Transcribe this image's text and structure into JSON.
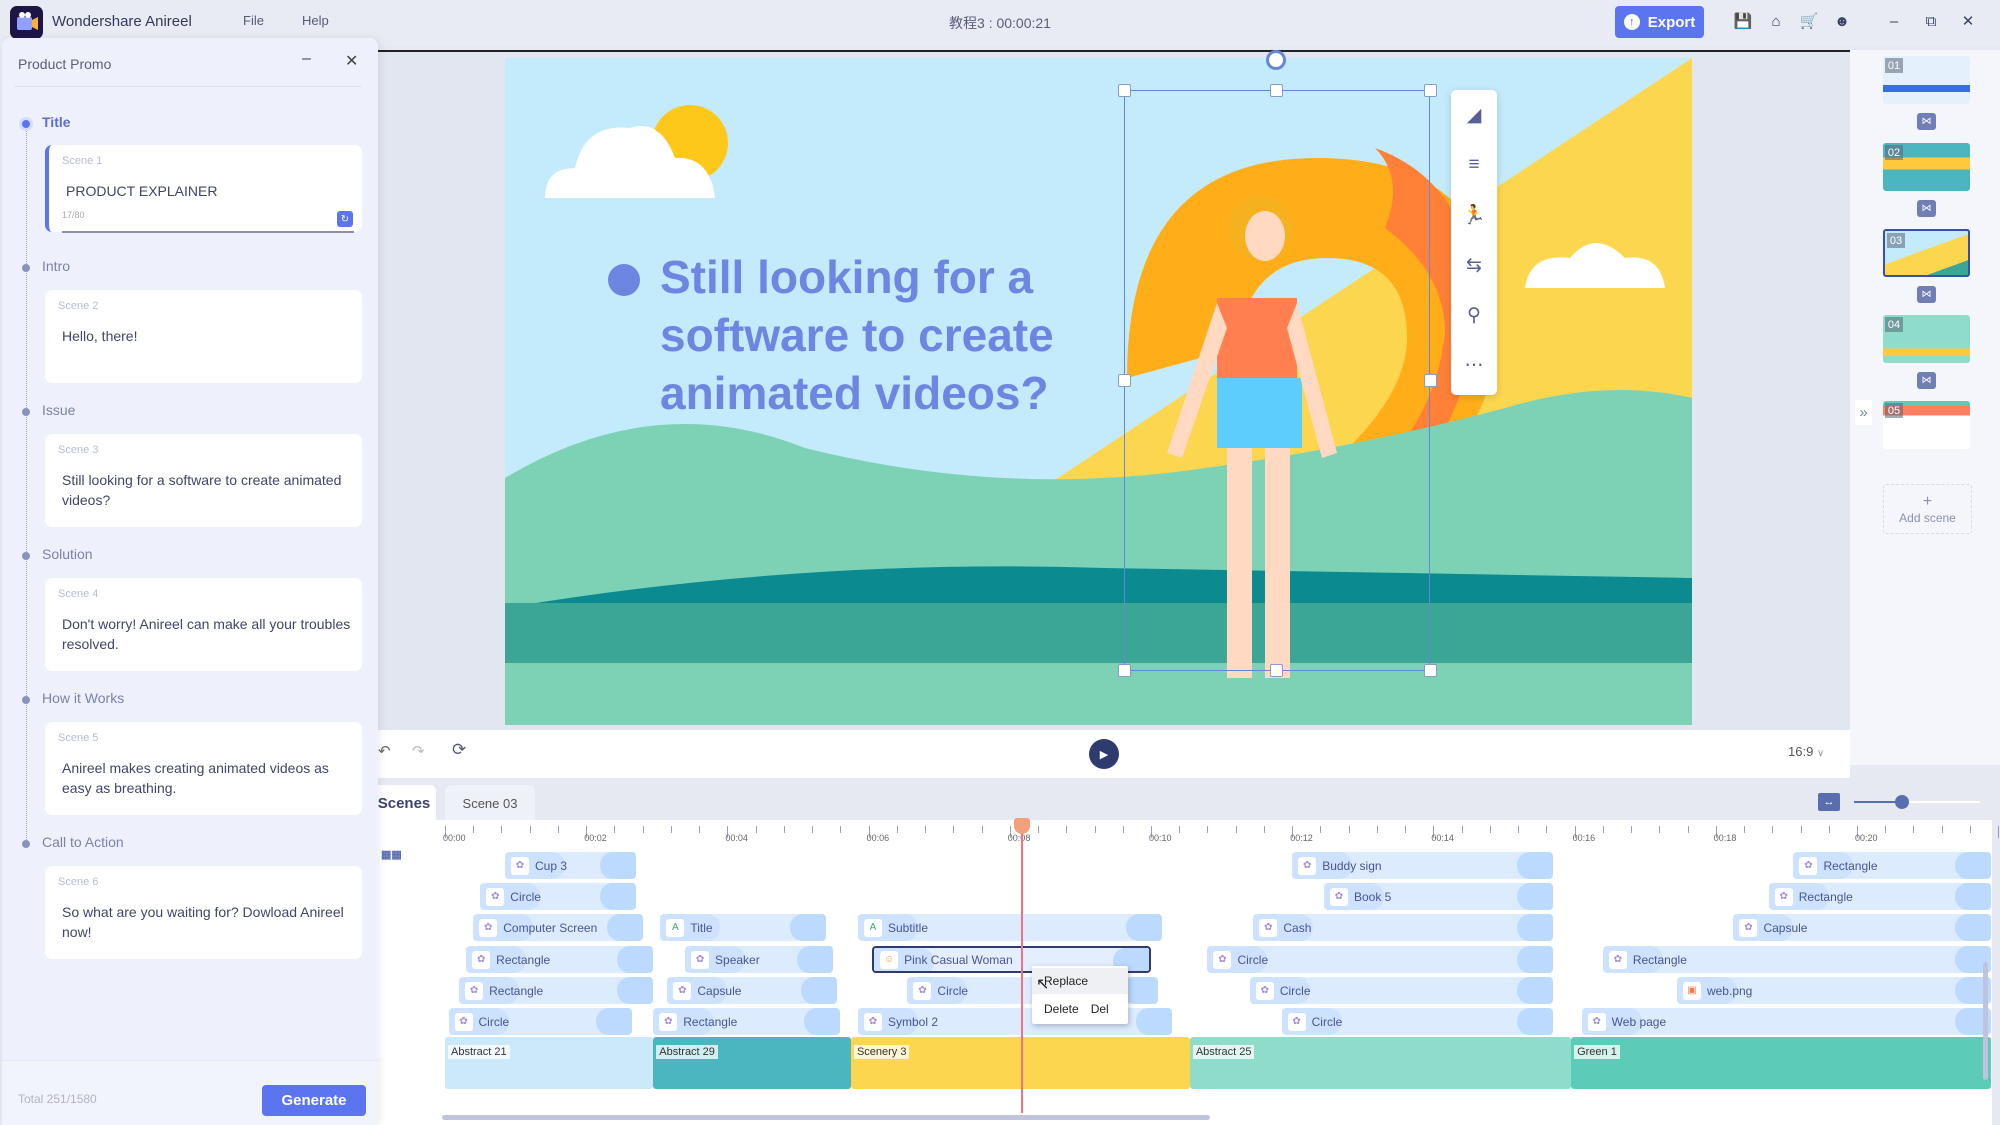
{
  "app": {
    "name": "Wondershare Anireel",
    "menus": [
      "File",
      "Help"
    ],
    "doc_title": "教程3 : 00:00:21"
  },
  "toolbar": {
    "export_label": "Export",
    "icons": [
      "save-icon",
      "home-icon",
      "cart-icon",
      "user-icon"
    ],
    "window": [
      "minimize",
      "restore",
      "close"
    ]
  },
  "left_panel": {
    "title": "Product Promo",
    "sections": [
      {
        "label": "Title",
        "scene": "Scene 1",
        "text": "PRODUCT EXPLAINER",
        "counter": "17/80",
        "active": true
      },
      {
        "label": "Intro",
        "scene": "Scene 2",
        "text": "Hello, there!"
      },
      {
        "label": "Issue",
        "scene": "Scene 3",
        "text": "Still looking for a software to create animated videos?"
      },
      {
        "label": "Solution",
        "scene": "Scene 4",
        "text": "Don't worry! Anireel can make all your troubles resolved."
      },
      {
        "label": "How it Works",
        "scene": "Scene 5",
        "text": "Anireel makes creating animated videos as easy as breathing."
      },
      {
        "label": "Call to Action",
        "scene": "Scene 6",
        "text": "So what are you waiting for? Dowload Anireel now!"
      }
    ],
    "total": "Total 251/1580",
    "generate_label": "Generate"
  },
  "canvas": {
    "headline": "Still looking for a software to create animated videos?",
    "colors": {
      "sky": "#c3ebfb",
      "yellow": "#fdd64f",
      "orange": "#ffae1a",
      "teal": "#0b8a90",
      "accent": "#6c86e2"
    },
    "float_toolbar": [
      "flip-icon",
      "layers-icon",
      "animation-icon",
      "transition-icon",
      "path-icon",
      "more-icon"
    ]
  },
  "controls": {
    "aspect_ratio": "16:9"
  },
  "scene_strip": {
    "scenes": [
      "01",
      "02",
      "03",
      "04",
      "05"
    ],
    "selected": "03",
    "add_label": "Add scene",
    "add_icon": "+"
  },
  "timeline": {
    "tabs": [
      "Scenes",
      "Scene 03"
    ],
    "ticks": [
      "00:00",
      "00:02",
      "00:04",
      "00:06",
      "00:08",
      "00:10",
      "00:12",
      "00:14",
      "00:16",
      "00:18",
      "00:20"
    ],
    "zoom_level": 0.37,
    "playhead_time": "00:08",
    "clips": [
      {
        "label": "Cup 3",
        "row": 0,
        "start": 0.85,
        "end": 2.7,
        "icon": "shape"
      },
      {
        "label": "Circle",
        "row": 1,
        "start": 0.5,
        "end": 2.7,
        "icon": "shape"
      },
      {
        "label": "Computer Screen",
        "row": 2,
        "start": 0.4,
        "end": 2.8,
        "icon": "shape"
      },
      {
        "label": "Rectangle",
        "row": 3,
        "start": 0.3,
        "end": 2.95,
        "icon": "shape"
      },
      {
        "label": "Rectangle",
        "row": 4,
        "start": 0.2,
        "end": 2.95,
        "icon": "shape"
      },
      {
        "label": "Circle",
        "row": 5,
        "start": 0.05,
        "end": 2.65,
        "icon": "shape"
      },
      {
        "label": "Title",
        "row": 2,
        "start": 3.05,
        "end": 5.4,
        "icon": "text"
      },
      {
        "label": "Speaker",
        "row": 3,
        "start": 3.4,
        "end": 5.5,
        "icon": "shape"
      },
      {
        "label": "Capsule",
        "row": 4,
        "start": 3.15,
        "end": 5.55,
        "icon": "shape"
      },
      {
        "label": "Rectangle",
        "row": 5,
        "start": 2.95,
        "end": 5.6,
        "icon": "shape"
      },
      {
        "label": "Subtitle",
        "row": 2,
        "start": 5.85,
        "end": 10.15,
        "icon": "text"
      },
      {
        "label": "Pink Casual Woman",
        "row": 3,
        "start": 6.05,
        "end": 10.0,
        "icon": "character",
        "selected": true
      },
      {
        "label": "Circle",
        "row": 4,
        "start": 6.55,
        "end": 10.1,
        "icon": "shape"
      },
      {
        "label": "Symbol 2",
        "row": 5,
        "start": 5.85,
        "end": 10.3,
        "icon": "shape"
      },
      {
        "label": "Buddy sign",
        "row": 0,
        "start": 12.0,
        "end": 15.7,
        "icon": "shape"
      },
      {
        "label": "Book 5",
        "row": 1,
        "start": 12.45,
        "end": 15.7,
        "icon": "shape"
      },
      {
        "label": "Cash",
        "row": 2,
        "start": 11.45,
        "end": 15.7,
        "icon": "shape"
      },
      {
        "label": "Circle",
        "row": 3,
        "start": 10.8,
        "end": 15.7,
        "icon": "shape"
      },
      {
        "label": "Circle",
        "row": 4,
        "start": 11.4,
        "end": 15.7,
        "icon": "shape"
      },
      {
        "label": "Circle",
        "row": 5,
        "start": 11.85,
        "end": 15.7,
        "icon": "shape"
      },
      {
        "label": "Rectangle",
        "row": 0,
        "start": 19.1,
        "end": 21.9,
        "icon": "shape"
      },
      {
        "label": "Rectangle",
        "row": 1,
        "start": 18.75,
        "end": 21.9,
        "icon": "shape"
      },
      {
        "label": "Capsule",
        "row": 2,
        "start": 18.25,
        "end": 21.9,
        "icon": "shape"
      },
      {
        "label": "Rectangle",
        "row": 3,
        "start": 16.4,
        "end": 21.9,
        "icon": "shape"
      },
      {
        "label": "web.png",
        "row": 4,
        "start": 17.45,
        "end": 21.9,
        "icon": "image"
      },
      {
        "label": "Web page",
        "row": 5,
        "start": 16.1,
        "end": 21.9,
        "icon": "shape"
      }
    ],
    "backgrounds": [
      {
        "label": "Abstract 21",
        "start": 0.0,
        "end": 2.95,
        "color": "#cbe9fb"
      },
      {
        "label": "Abstract 29",
        "start": 2.95,
        "end": 5.75,
        "color": "#4cb6c0"
      },
      {
        "label": "Scenery 3",
        "start": 5.75,
        "end": 10.55,
        "color": "#fdd64f"
      },
      {
        "label": "Abstract 25",
        "start": 10.55,
        "end": 15.95,
        "color": "#8fdcca"
      },
      {
        "label": "Green 1",
        "start": 15.95,
        "end": 21.9,
        "color": "#5ccbb8"
      }
    ],
    "context_menu": {
      "items": [
        {
          "label": "Replace",
          "shortcut": ""
        },
        {
          "label": "Delete",
          "shortcut": "Del"
        }
      ]
    }
  }
}
